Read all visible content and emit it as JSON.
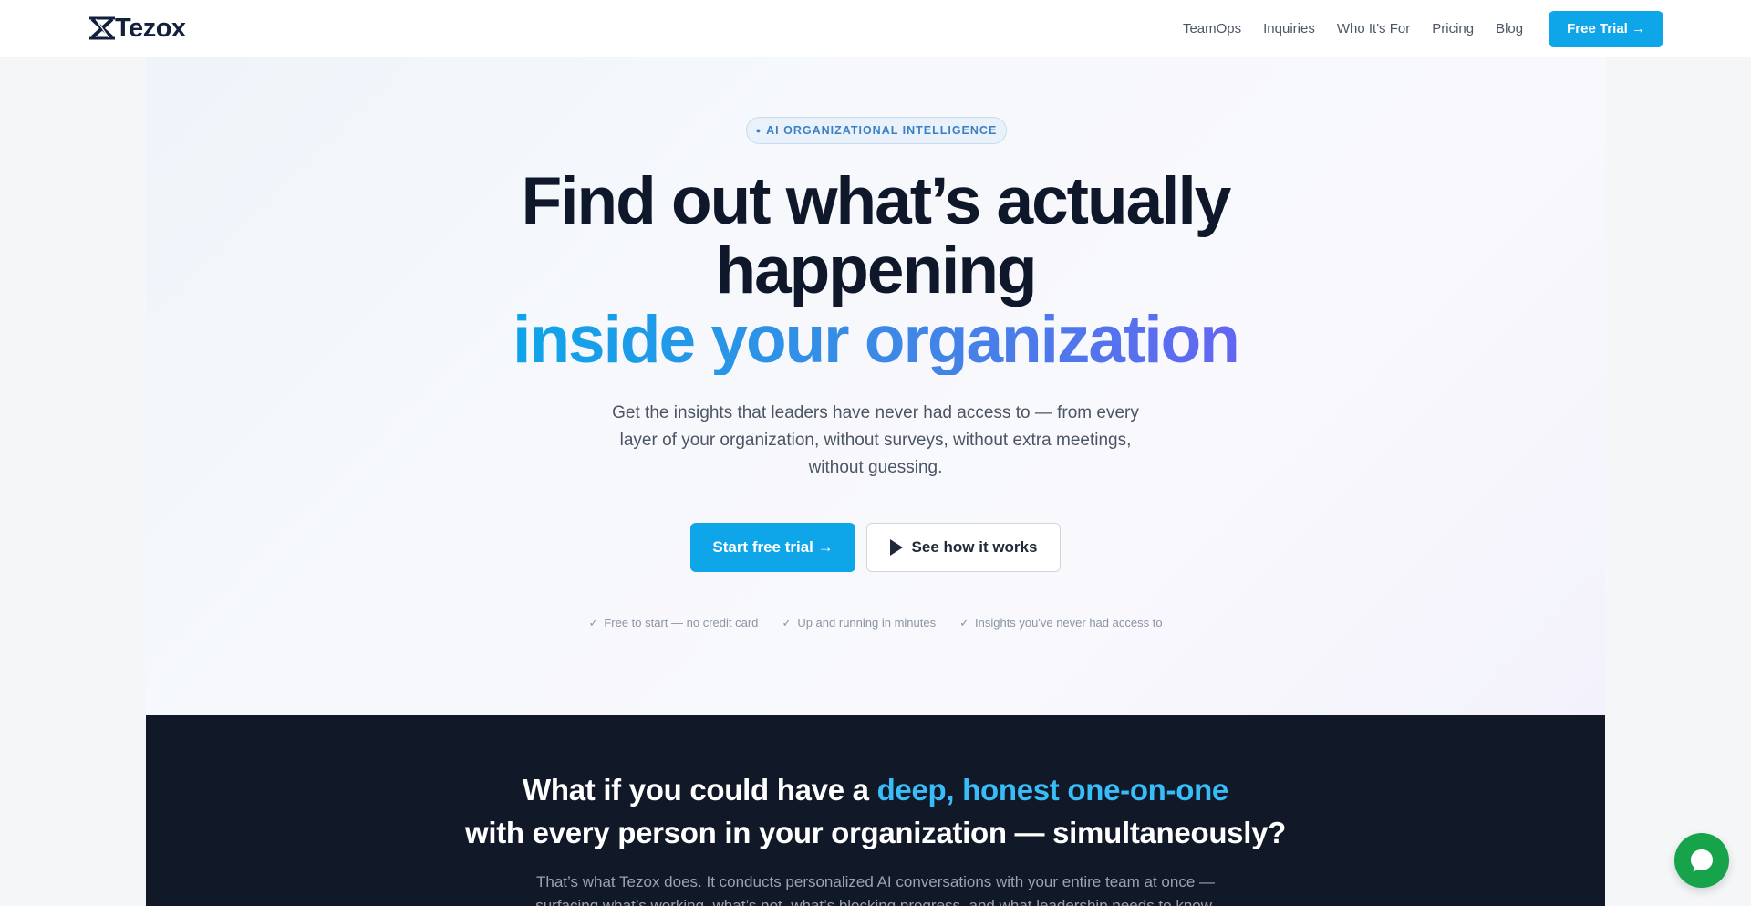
{
  "nav": {
    "logo_text": "Tezox",
    "links": [
      "TeamOps",
      "Inquiries",
      "Who It's For",
      "Pricing",
      "Blog"
    ],
    "cta_label": "Free Trial →"
  },
  "hero": {
    "badge": "AI ORGANIZATIONAL INTELLIGENCE",
    "badge_dot": "●",
    "headline_line1": "Find out what’s actually",
    "headline_line2": "happening",
    "headline_line3": "inside your organization",
    "subtitle": "Get the insights that leaders have never had access to — from every layer of your organization, without surveys, without extra meetings, without guessing.",
    "primary_button": "Start free trial →",
    "secondary_button": "See how it works",
    "check_mark": "✓",
    "checks": [
      "Free to start — no credit card",
      "Up and running in minutes",
      "Insights you've never had access to"
    ]
  },
  "section2": {
    "title_part1": "What if you could have a ",
    "title_highlight": "deep, honest one-on-one",
    "title_line2": "with every person in your organization — simultaneously?",
    "text": "That’s what Tezox does. It conducts personalized AI conversations with your entire team at once — surfacing what’s working, what’s not, what’s blocking progress, and what leadership needs to know."
  },
  "colors": {
    "accent": "#0ea5e9",
    "dark_bg": "#111827",
    "gradient_start": "#0ea5e9",
    "gradient_end": "#6366f1",
    "chat_green": "#16a34a"
  },
  "icons": {
    "logo": "tezox-logo-icon",
    "play": "play-icon",
    "check": "check-icon",
    "chat": "chat-bubble-icon"
  }
}
